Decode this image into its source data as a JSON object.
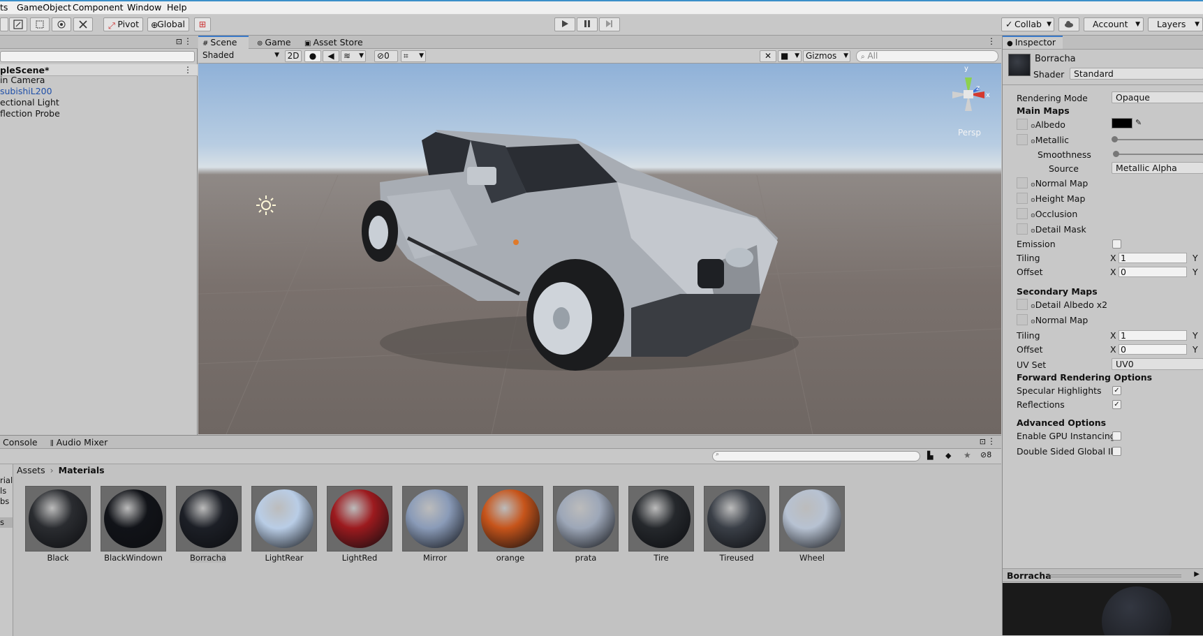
{
  "menu": {
    "item0": "ts",
    "item1": "GameObject",
    "item2": "Component",
    "item3": "Window",
    "item4": "Help"
  },
  "toolbar": {
    "pivot": "Pivot",
    "global": "Global",
    "collab": "Collab",
    "account": "Account",
    "layers": "Layers"
  },
  "hierarchy": {
    "scene": "pleScene*",
    "items": [
      "in Camera",
      "subishiL200",
      "ectional Light",
      "flection Probe"
    ]
  },
  "scene_tabs": [
    "Scene",
    "Game",
    "Asset Store"
  ],
  "scene_toolbar": {
    "shading": "Shaded",
    "two_d": "2D",
    "hidden_count": "0",
    "gizmos": "Gizmos",
    "search_placeholder": "All",
    "persp": "Persp"
  },
  "gizmo_axes": {
    "x": "x",
    "y": "y",
    "z": "z"
  },
  "bottom_tabs": [
    "Console",
    "Audio Mixer"
  ],
  "project": {
    "breadcrumb": [
      "Assets",
      "Materials"
    ],
    "left_items": [
      "rials",
      "ls",
      "bs",
      "s"
    ],
    "filter_count": "8",
    "materials": [
      {
        "name": "Black",
        "color": "#2a2c30"
      },
      {
        "name": "BlackWindown",
        "color": "#111318"
      },
      {
        "name": "Borracha",
        "color": "#1c1f26"
      },
      {
        "name": "LightRear",
        "color": "#b9cde6"
      },
      {
        "name": "LightRed",
        "color": "#9c1a1e"
      },
      {
        "name": "Mirror",
        "color": "#8a9bb8"
      },
      {
        "name": "orange",
        "color": "#c6541a"
      },
      {
        "name": "prata",
        "color": "#9da7b8"
      },
      {
        "name": "Tire",
        "color": "#25282c"
      },
      {
        "name": "Tireused",
        "color": "#3a3f47"
      },
      {
        "name": "Wheel",
        "color": "#b7c2d2"
      }
    ],
    "selected": "Borracha"
  },
  "inspector": {
    "tab": "Inspector",
    "name": "Borracha",
    "shader_label": "Shader",
    "shader": "Standard",
    "rendering_mode_label": "Rendering Mode",
    "rendering_mode": "Opaque",
    "main_maps": "Main Maps",
    "albedo": "Albedo",
    "metallic": "Metallic",
    "smoothness": "Smoothness",
    "source_label": "Source",
    "source": "Metallic Alpha",
    "normal_map": "Normal Map",
    "height_map": "Height Map",
    "occlusion": "Occlusion",
    "detail_mask": "Detail Mask",
    "emission": "Emission",
    "tiling": "Tiling",
    "offset": "Offset",
    "x": "X",
    "y": "Y",
    "tiling_x": "1",
    "offset_x": "0",
    "secondary_maps": "Secondary Maps",
    "detail_albedo": "Detail Albedo x2",
    "normal_map2": "Normal Map",
    "tiling2_x": "1",
    "offset2_x": "0",
    "uv_set_label": "UV Set",
    "uv_set": "UV0",
    "forward": "Forward Rendering Options",
    "specular": "Specular Highlights",
    "reflections": "Reflections",
    "advanced": "Advanced Options",
    "gpu_instancing": "Enable GPU Instancing",
    "double_sided": "Double Sided Global Illu",
    "preview_title": "Borracha",
    "check": "✓"
  },
  "colors": {
    "accent": "#3a79c9",
    "hierarchy_link": "#1f4fa8"
  }
}
